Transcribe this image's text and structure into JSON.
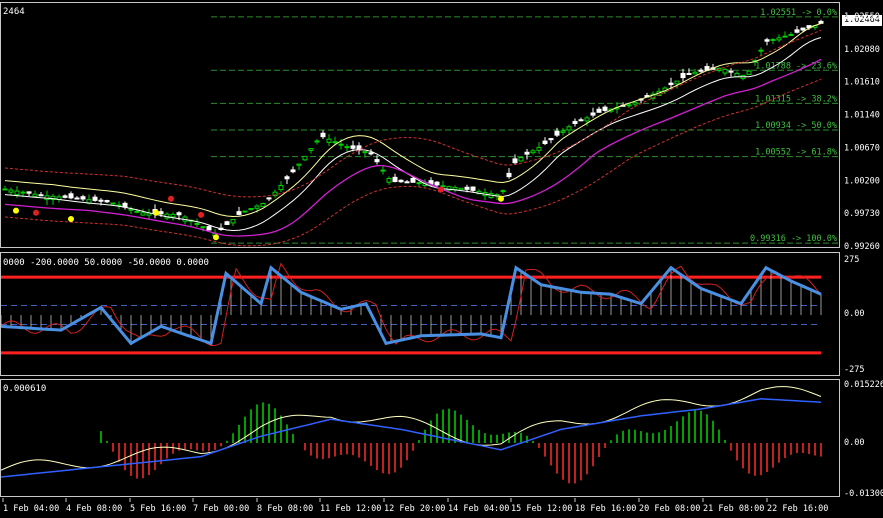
{
  "main": {
    "title": "2464",
    "price_axis": [
      "1.02550",
      "1.02080",
      "1.01610",
      "1.01140",
      "1.00670",
      "1.00200",
      "0.99730",
      "0.99260"
    ],
    "current_price": "1.02464",
    "fib_levels": [
      {
        "label": "1.02551 -> 0.0%",
        "price": 1.02551
      },
      {
        "label": "1.01788 -> 23.6%",
        "price": 1.01788
      },
      {
        "label": "1.01315 -> 38.2%",
        "price": 1.01315
      },
      {
        "label": "1.00934 -> 50.0%",
        "price": 1.00934
      },
      {
        "label": "1.00552 -> 61.8%",
        "price": 1.00552
      },
      {
        "label": "0.99316 -> 100.0%",
        "price": 0.99316
      }
    ],
    "colors": {
      "up": "#00d000",
      "down": "#ffffff",
      "fib": "#2e8b2e",
      "ma_slow": "#d020d0",
      "ma_fast": "#ffffa0",
      "env": "#d03030"
    }
  },
  "cci": {
    "title": "0000 -200.0000 50.0000 -50.0000 0.0000",
    "axis": [
      "275",
      "0.00",
      "-275"
    ],
    "levels": [
      200,
      50,
      -50,
      -200
    ],
    "colors": {
      "line": "#4a90e2",
      "signal": "#d02020",
      "level": "#ff2020",
      "histo": "#ffffff"
    }
  },
  "macd": {
    "title": "0.000610",
    "axis": [
      "0.015226",
      "0.00",
      "-0.013003"
    ],
    "colors": {
      "up": "#00a000",
      "down": "#c02020",
      "signal": "#ffffc0",
      "main": "#3060ff"
    }
  },
  "time_axis": [
    "1 Feb 04:00",
    "4 Feb 08:00",
    "5 Feb 16:00",
    "7 Feb 00:00",
    "8 Feb 08:00",
    "11 Feb 12:00",
    "12 Feb 20:00",
    "14 Feb 04:00",
    "15 Feb 12:00",
    "18 Feb 16:00",
    "20 Feb 08:00",
    "21 Feb 08:00",
    "22 Feb 16:00"
  ]
}
